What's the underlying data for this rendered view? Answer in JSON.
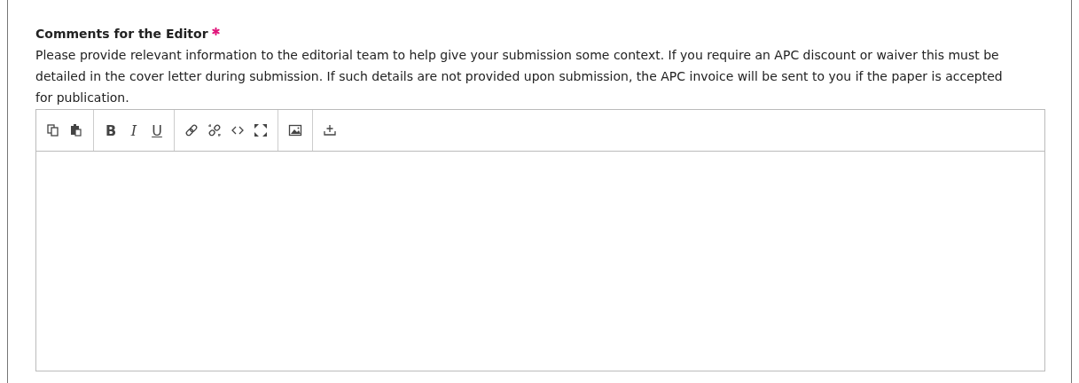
{
  "field": {
    "label": "Comments for the Editor",
    "required": true,
    "description": "Please provide relevant information to the editorial team to help give your submission some context. If you require an APC discount or waiver this must be detailed in the cover letter during submission. If such details are not provided upon submission, the APC invoice will be sent to you if the paper is accepted for publication."
  },
  "toolbar": [
    [
      {
        "kind": "copy"
      },
      {
        "kind": "paste"
      }
    ],
    [
      {
        "kind": "bold",
        "label": "B"
      },
      {
        "kind": "italic",
        "label": "I"
      },
      {
        "kind": "underline",
        "label": "U"
      }
    ],
    [
      {
        "kind": "link"
      },
      {
        "kind": "unlink"
      },
      {
        "kind": "code"
      },
      {
        "kind": "fullscreen"
      }
    ],
    [
      {
        "kind": "image"
      }
    ],
    [
      {
        "kind": "upload"
      }
    ]
  ]
}
